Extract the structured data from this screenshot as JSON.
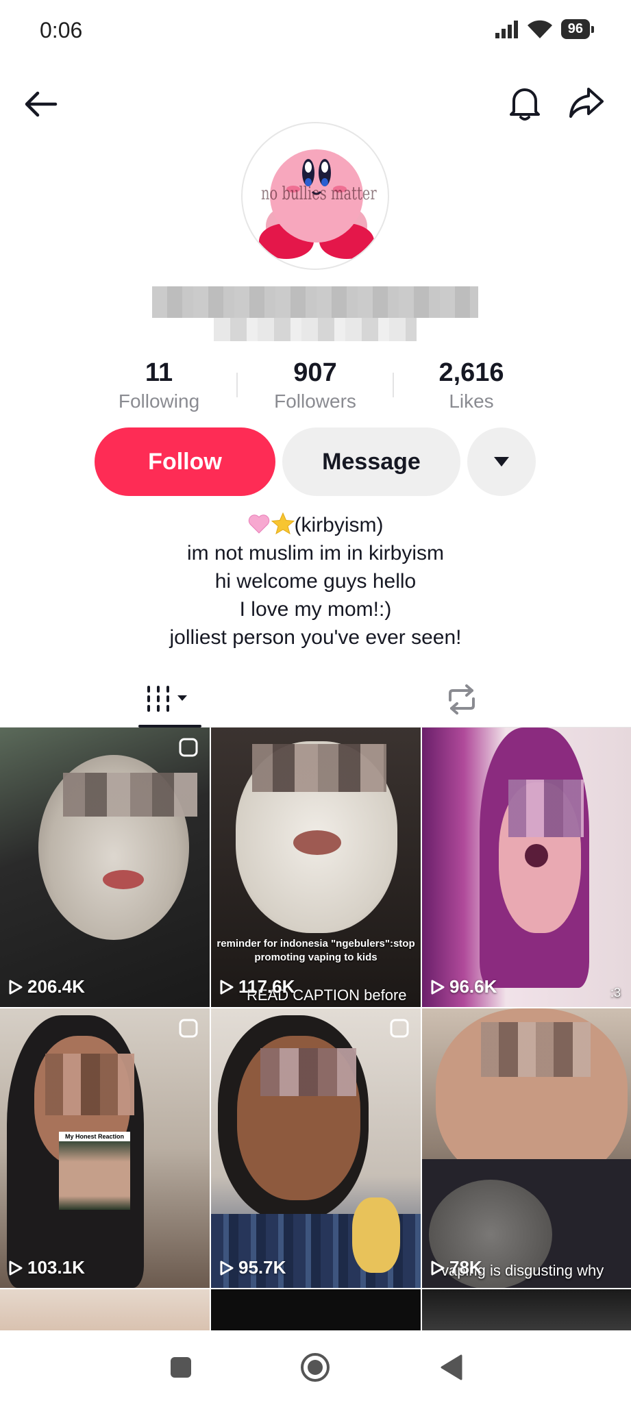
{
  "status_bar": {
    "time": "0:06",
    "battery": "96",
    "icons": [
      "signal-icon",
      "wifi-icon",
      "battery-icon"
    ]
  },
  "top_bar": {
    "icons": [
      "back-arrow-icon",
      "bell-icon",
      "share-icon"
    ]
  },
  "profile": {
    "avatar_text": "no bullies matter",
    "stats": [
      {
        "value": "11",
        "label": "Following"
      },
      {
        "value": "907",
        "label": "Followers"
      },
      {
        "value": "2,616",
        "label": "Likes"
      }
    ],
    "follow_label": "Follow",
    "message_label": "Message",
    "bio_lines": [
      "(kirbyism)",
      "im not muslim im in kirbyism",
      "hi welcome guys hello",
      "I love my mom!:)",
      "jolliest person you've ever seen!"
    ]
  },
  "tabs": [
    {
      "name": "videos",
      "icon": "grid-icon",
      "active": true
    },
    {
      "name": "reposts",
      "icon": "repost-icon",
      "active": false
    }
  ],
  "videos": [
    {
      "views": "206.4K",
      "pinned": true
    },
    {
      "views": "117.6K",
      "pinned": false,
      "caption": "reminder for indonesia \"ngebulers\":stop promoting vaping to kids",
      "caption2": "READ CAPTION before"
    },
    {
      "views": "96.6K",
      "pinned": false,
      "caption2": ":3"
    },
    {
      "views": "103.1K",
      "pinned": true,
      "inset_label": "My Honest Reaction"
    },
    {
      "views": "95.7K",
      "pinned": true
    },
    {
      "views": "78K",
      "pinned": false,
      "caption2": "vaping is disgusting why"
    }
  ],
  "colors": {
    "accent": "#fe2c55",
    "secondary_button": "#efefef",
    "text_primary": "#161823",
    "text_secondary": "#8a8b91"
  }
}
